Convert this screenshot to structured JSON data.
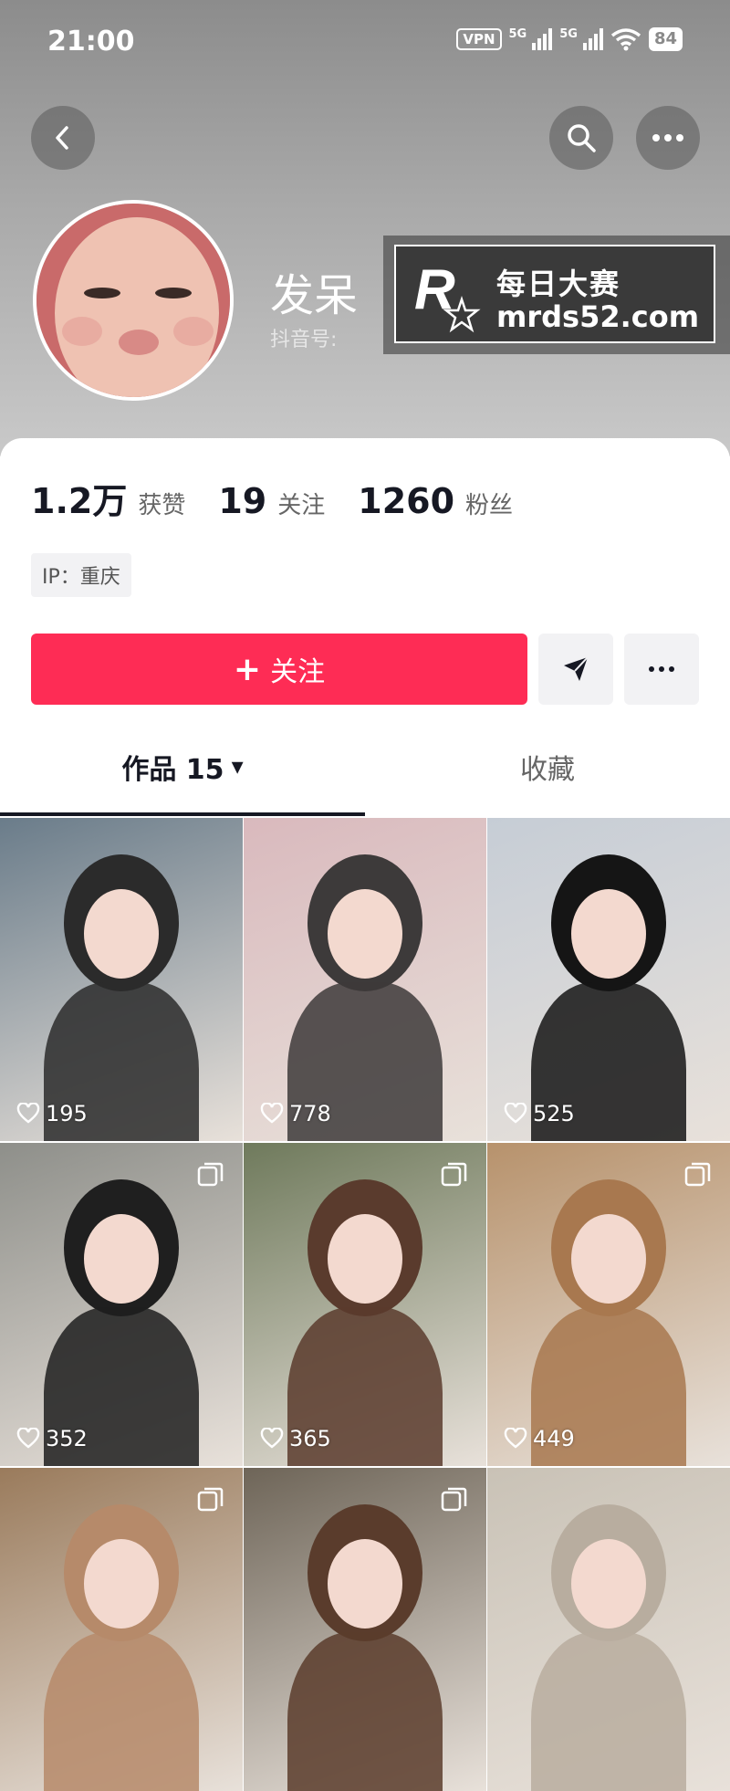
{
  "status_bar": {
    "time": "21:00",
    "vpn": "VPN",
    "sim1": "5G",
    "sim2": "5G",
    "battery": "84"
  },
  "profile": {
    "nickname": "发呆",
    "douyin_id_label": "抖音号: "
  },
  "watermark": {
    "line1": "每日大赛",
    "line2": "mrds52.com",
    "logo_letter": "R",
    "logo_sub": "每日大赛"
  },
  "stats": [
    {
      "value": "1.2万",
      "label": "获赞"
    },
    {
      "value": "19",
      "label": "关注"
    },
    {
      "value": "1260",
      "label": "粉丝"
    }
  ],
  "ip_tag": "IP：重庆",
  "actions": {
    "follow_plus": "+",
    "follow_label": "关注"
  },
  "tabs": {
    "works": "作品 15",
    "works_caret": "▾",
    "favorites": "收藏"
  },
  "grid": [
    {
      "likes": "195",
      "multi": false,
      "bg": "#6a7c8a",
      "accent": "#2b2b2b"
    },
    {
      "likes": "778",
      "multi": false,
      "bg": "#d9b9bd",
      "accent": "#3d3a3a"
    },
    {
      "likes": "525",
      "multi": false,
      "bg": "#c6cdd6",
      "accent": "#151515"
    },
    {
      "likes": "352",
      "multi": true,
      "bg": "#8e8f8a",
      "accent": "#1f1f1f"
    },
    {
      "likes": "365",
      "multi": true,
      "bg": "#6f7a5c",
      "accent": "#5a3b2d"
    },
    {
      "likes": "449",
      "multi": true,
      "bg": "#b7926c",
      "accent": "#a8784f"
    },
    {
      "likes": "",
      "multi": true,
      "bg": "#9a7b5c",
      "accent": "#b68a6a"
    },
    {
      "likes": "",
      "multi": true,
      "bg": "#6e6558",
      "accent": "#5a3c2c"
    },
    {
      "likes": "",
      "multi": false,
      "bg": "#c9c2b6",
      "accent": "#b8ad9f"
    }
  ],
  "colors": {
    "follow": "#fe2c55",
    "text": "#161823",
    "muted": "#666666"
  }
}
